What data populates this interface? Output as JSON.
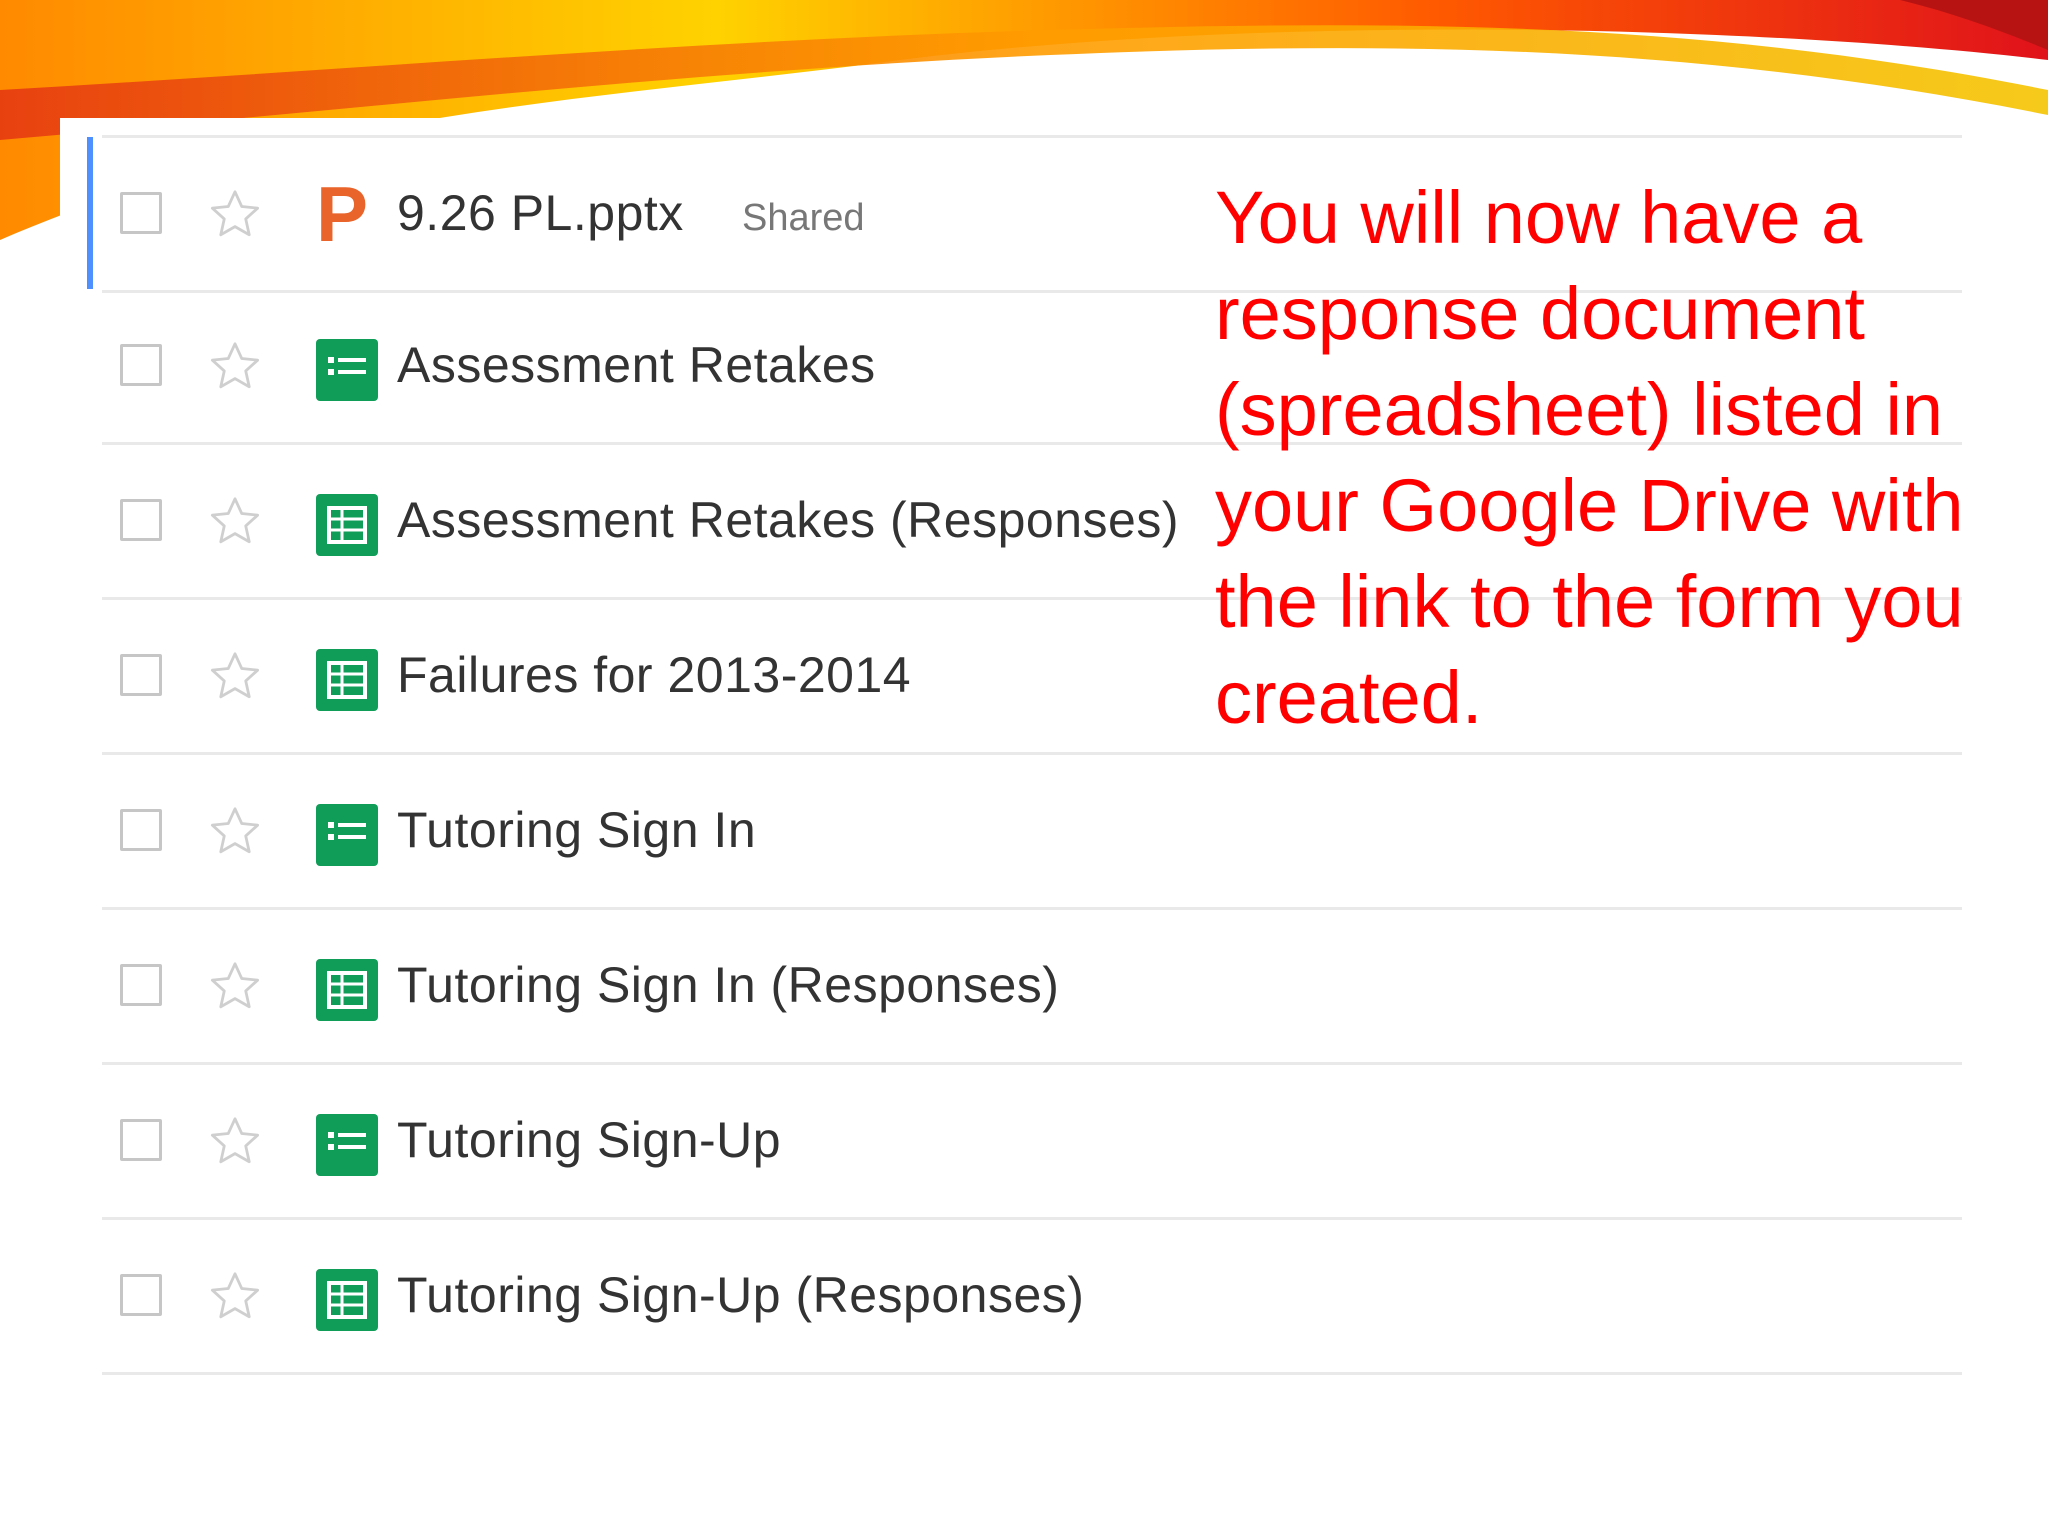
{
  "colors": {
    "accent": "#4d90fe",
    "sheets_green": "#0f9d58",
    "powerpoint_orange": "#e8642b",
    "note_red": "#ff0000"
  },
  "files": [
    {
      "name": "9.26 PL.pptx",
      "badge": "Shared",
      "icon": "powerpoint-icon",
      "selected": true
    },
    {
      "name": "Assessment Retakes",
      "icon": "forms-icon"
    },
    {
      "name": "Assessment Retakes (Responses)",
      "icon": "sheets-icon"
    },
    {
      "name": "Failures for 2013-2014",
      "icon": "sheets-icon"
    },
    {
      "name": "Tutoring Sign In",
      "icon": "forms-icon"
    },
    {
      "name": "Tutoring Sign In (Responses)",
      "icon": "sheets-icon"
    },
    {
      "name": "Tutoring Sign-Up",
      "icon": "forms-icon"
    },
    {
      "name": "Tutoring Sign-Up (Responses)",
      "icon": "sheets-icon"
    }
  ],
  "note": {
    "text": "You will now have a response document (spreadsheet) listed in your Google Drive with the link to the form you created."
  }
}
